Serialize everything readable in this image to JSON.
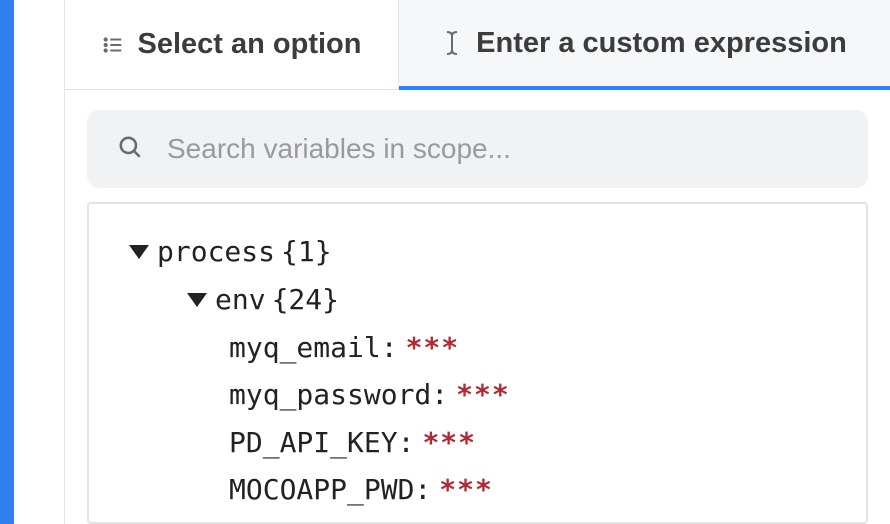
{
  "tabs": {
    "select_label": "Select an option",
    "custom_label": "Enter a custom expression"
  },
  "search": {
    "placeholder": "Search variables in scope..."
  },
  "tree": {
    "root": {
      "key": "process",
      "count": "{1}"
    },
    "env": {
      "key": "env",
      "count": "{24}"
    },
    "vars": [
      {
        "key": "myq_email:",
        "value": "***"
      },
      {
        "key": "myq_password:",
        "value": "***"
      },
      {
        "key": "PD_API_KEY:",
        "value": "***"
      },
      {
        "key": "MOCOAPP_PWD:",
        "value": "***"
      }
    ]
  }
}
